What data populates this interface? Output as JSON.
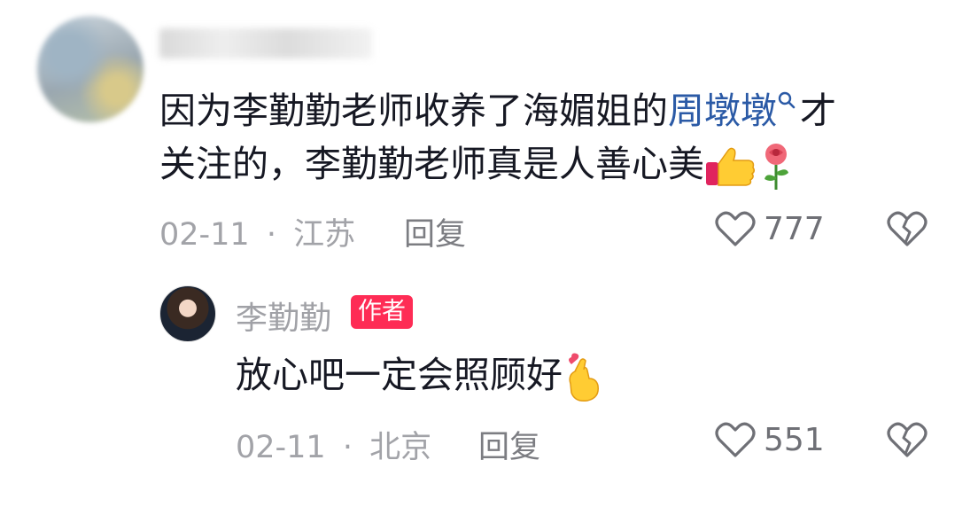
{
  "comment": {
    "text_line1": "因为李勤勤老师收养了海媚姐的",
    "mention": "周墩墩",
    "text_line1_end": "才",
    "text_line2": "关注的，李勤勤老师真是人善心美",
    "date": "02-11",
    "separator": "·",
    "location": "江苏",
    "reply_label": "回复",
    "like_count": "777",
    "icons": [
      "thumbs-up-emoji",
      "rose-emoji",
      "heart-outline-icon",
      "broken-heart-icon",
      "search-icon"
    ]
  },
  "reply": {
    "author_name": "李勤勤",
    "badge": "作者",
    "text": "放心吧一定会照顾好",
    "date": "02-11",
    "separator": "·",
    "location": "北京",
    "reply_label": "回复",
    "like_count": "551",
    "icons": [
      "finger-heart-emoji",
      "heart-outline-icon",
      "broken-heart-icon"
    ]
  },
  "colors": {
    "mention": "#2b5aa6",
    "badge": "#fe2c55",
    "meta": "#a2a3a8"
  }
}
